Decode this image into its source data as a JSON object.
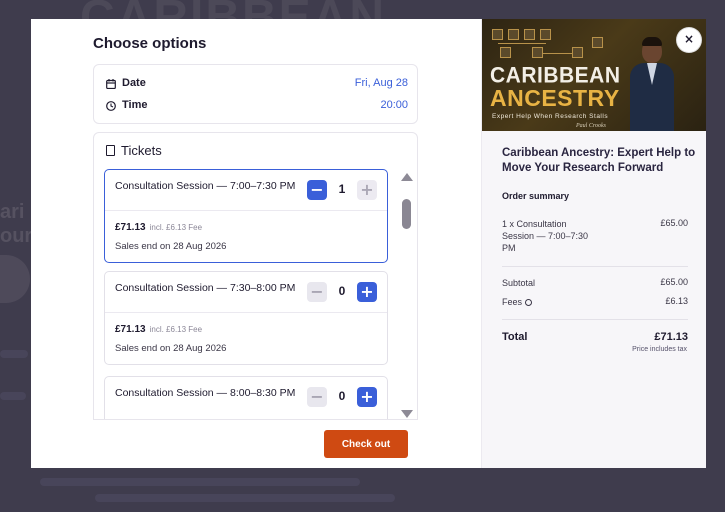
{
  "background": {
    "title": "CARIBBEAN",
    "side_lines": [
      "ari",
      "our"
    ]
  },
  "modal": {
    "heading": "Choose options",
    "date": {
      "label": "Date",
      "value": "Fri, Aug 28"
    },
    "time": {
      "label": "Time",
      "value": "20:00"
    },
    "tickets_heading": "Tickets",
    "tickets": [
      {
        "name": "Consultation Session — 7:00–7:30 PM",
        "quantity": "1",
        "price": "£71.13",
        "fee": "incl. £6.13 Fee",
        "sales_end": "Sales end on 28 Aug 2026",
        "selected": true
      },
      {
        "name": "Consultation Session — 7:30–8:00 PM",
        "quantity": "0",
        "price": "£71.13",
        "fee": "incl. £6.13 Fee",
        "sales_end": "Sales end on 28 Aug 2026",
        "selected": false
      },
      {
        "name": "Consultation Session — 8:00–8:30 PM",
        "quantity": "0",
        "selected": false
      }
    ],
    "checkout_label": "Check out",
    "close_label": "×"
  },
  "banner": {
    "line1": "CARIBBEAN",
    "line2": "ANCESTRY",
    "tagline": "Expert Help When Research Stalls",
    "signature": "Paul Crooks"
  },
  "summary": {
    "event_title": "Caribbean Ancestry: Expert Help to Move Your Research Forward",
    "heading": "Order summary",
    "line_item": {
      "label": "1 x Consultation Session — 7:00–7:30 PM",
      "value": "£65.00"
    },
    "subtotal": {
      "label": "Subtotal",
      "value": "£65.00"
    },
    "fees": {
      "label": "Fees",
      "value": "£6.13"
    },
    "total": {
      "label": "Total",
      "value": "£71.13"
    },
    "tax_note": "Price includes tax"
  },
  "colors": {
    "accent": "#3a5fd9",
    "checkout": "#cf4a12",
    "gold": "#e8b344"
  },
  "icons": [
    "calendar-icon",
    "clock-icon",
    "ticket-icon",
    "close-icon",
    "info-icon",
    "minus-icon",
    "plus-icon"
  ]
}
